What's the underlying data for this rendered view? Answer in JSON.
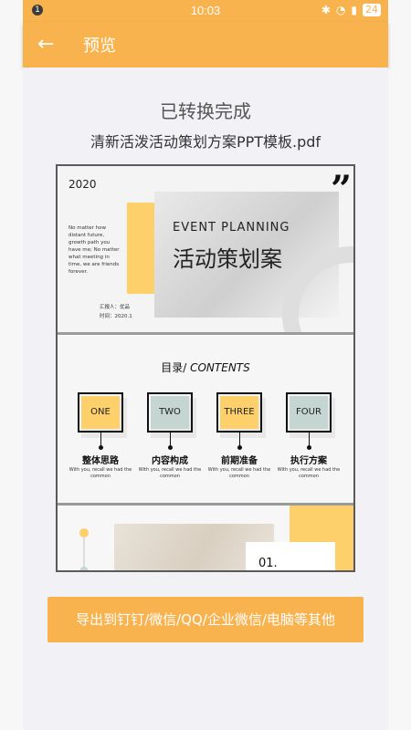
{
  "statusbar": {
    "time": "10:03",
    "notification": "1",
    "battery": "24"
  },
  "appbar": {
    "title": "预览",
    "back_icon": "arrow-left-icon"
  },
  "content": {
    "status_title": "已转换完成",
    "filename": "清新活泼活动策划方案PPT模板.pdf"
  },
  "slide1": {
    "year": "2020",
    "side_text": "No matter how distant future, growth path you have me; No matter what meeting in time, we are friends forever.",
    "quote": "”",
    "event": "EVENT PLANNING",
    "title_cn": "活动策划案",
    "meta_reporter": "汇报人：优品",
    "meta_time": "时间：2020.1"
  },
  "slide2": {
    "title_cn": "目录/",
    "title_en": "CONTENTS",
    "items": [
      {
        "card": "ONE",
        "label": "整体思路",
        "sub": "With you, recall we had the common"
      },
      {
        "card": "TWO",
        "label": "内容构成",
        "sub": "With you, recall we had the common"
      },
      {
        "card": "THREE",
        "label": "前期准备",
        "sub": "With you, recall we had the common"
      },
      {
        "card": "FOUR",
        "label": "执行方案",
        "sub": "With you, recall we had the common"
      }
    ]
  },
  "slide3": {
    "number": "01."
  },
  "export": {
    "label": "导出到钉钉/微信/QQ/企业微信/电脑等其他"
  },
  "colors": {
    "accent": "#f8b34f",
    "slide_yellow": "#fdd06b",
    "slide_gray": "#c5d5d2"
  }
}
